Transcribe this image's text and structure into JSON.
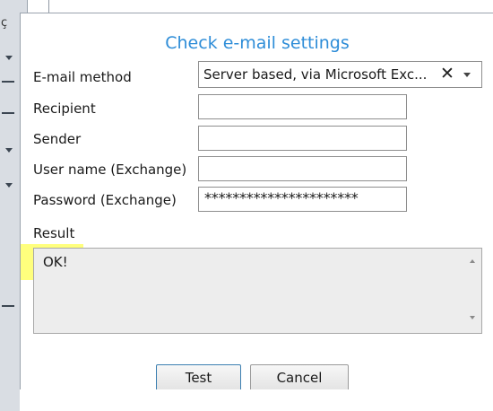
{
  "dialog": {
    "title": "Check e-mail settings",
    "fields": {
      "email_method": {
        "label": "E-mail method",
        "value": "Server based, via Microsoft Exc...",
        "clear_icon": "✕"
      },
      "recipient": {
        "label": "Recipient",
        "value": ""
      },
      "sender": {
        "label": "Sender",
        "value": ""
      },
      "username": {
        "label": "User name (Exchange)",
        "value": ""
      },
      "password": {
        "label": "Password (Exchange)",
        "value": "**********************"
      }
    },
    "result": {
      "label": "Result",
      "value": "OK!"
    },
    "buttons": {
      "test": "Test",
      "cancel": "Cancel"
    }
  },
  "background": {
    "edge_char": "ç"
  },
  "colors": {
    "title": "#2e8dd8",
    "highlight": "#ffff66",
    "default_button_border": "#3c7fb1"
  }
}
